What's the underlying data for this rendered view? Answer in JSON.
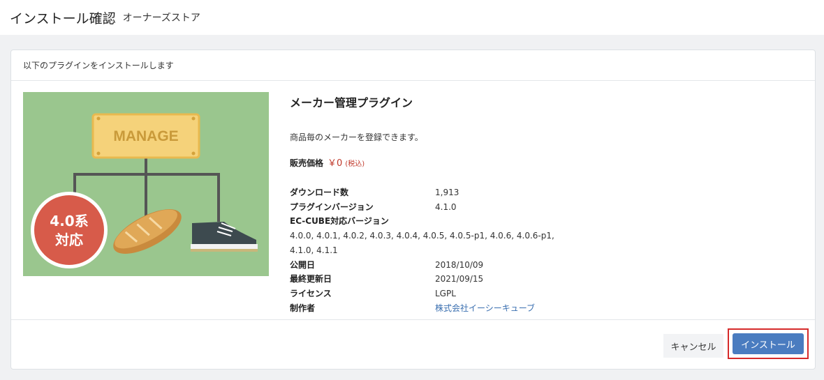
{
  "header": {
    "title": "インストール確認",
    "subtitle": "オーナーズストア"
  },
  "card": {
    "heading": "以下のプラグインをインストールします"
  },
  "thumbnail": {
    "sign_text": "MANAGE",
    "badge_line1": "4.0系",
    "badge_line2": "対応"
  },
  "plugin": {
    "name": "メーカー管理プラグイン",
    "description": "商品毎のメーカーを登録できます。",
    "price_label": "販売価格",
    "price_value": "￥0",
    "price_tax": "(税込)",
    "downloads_label": "ダウンロード数",
    "downloads_value": "1,913",
    "version_label": "プラグインバージョン",
    "version_value": "4.1.0",
    "eccube_label": "EC-CUBE対応バージョン",
    "eccube_line1": "4.0.0, 4.0.1, 4.0.2, 4.0.3, 4.0.4, 4.0.5, 4.0.5-p1, 4.0.6, 4.0.6-p1,",
    "eccube_line2": "4.1.0, 4.1.1",
    "published_label": "公開日",
    "published_value": "2018/10/09",
    "updated_label": "最終更新日",
    "updated_value": "2021/09/15",
    "license_label": "ライセンス",
    "license_value": "LGPL",
    "author_label": "制作者",
    "author_value": "株式会社イーシーキューブ"
  },
  "actions": {
    "cancel_label": "キャンセル",
    "install_label": "インストール"
  },
  "colors": {
    "accent": "#4a7cc0",
    "price": "#c0392b",
    "link": "#3a6fb0",
    "highlight": "#d62a2a"
  }
}
